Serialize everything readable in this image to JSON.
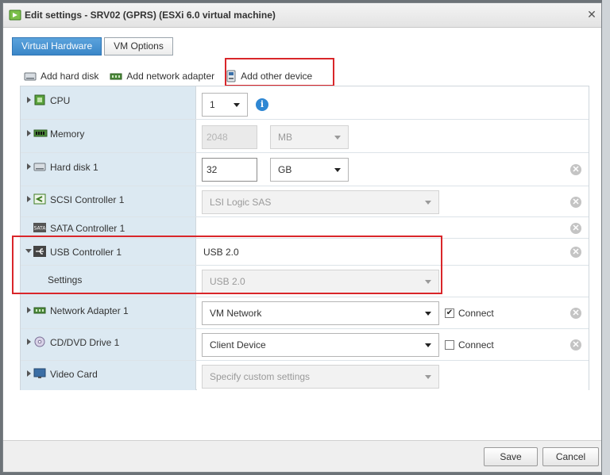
{
  "dialog": {
    "title": "Edit settings - SRV02 (GPRS) (ESXi 6.0 virtual machine)"
  },
  "tabs": [
    {
      "label": "Virtual Hardware",
      "active": true
    },
    {
      "label": "VM Options",
      "active": false
    }
  ],
  "toolbar": {
    "add_hard_disk": "Add hard disk",
    "add_network_adapter": "Add network adapter",
    "add_other_device": "Add other device"
  },
  "hardware": {
    "cpu": {
      "label": "CPU",
      "value": "1"
    },
    "memory": {
      "label": "Memory",
      "value": "2048",
      "unit": "MB"
    },
    "hard_disk": {
      "label": "Hard disk 1",
      "value": "32",
      "unit": "GB"
    },
    "scsi": {
      "label": "SCSI Controller 1",
      "value": "LSI Logic SAS"
    },
    "sata": {
      "label": "SATA Controller 1"
    },
    "usb": {
      "label": "USB Controller 1",
      "value": "USB 2.0",
      "settings_label": "Settings",
      "settings_value": "USB 2.0"
    },
    "network": {
      "label": "Network Adapter 1",
      "value": "VM Network",
      "connect_label": "Connect",
      "connected": true
    },
    "cdrom": {
      "label": "CD/DVD Drive 1",
      "value": "Client Device",
      "connect_label": "Connect",
      "connected": false
    },
    "video": {
      "label": "Video Card",
      "value": "Specify custom settings"
    }
  },
  "footer": {
    "save_label": "Save",
    "cancel_label": "Cancel"
  },
  "colors": {
    "highlight": "#d9262a",
    "tab_active": "#3a86c8",
    "label_column": "#dce9f2"
  }
}
